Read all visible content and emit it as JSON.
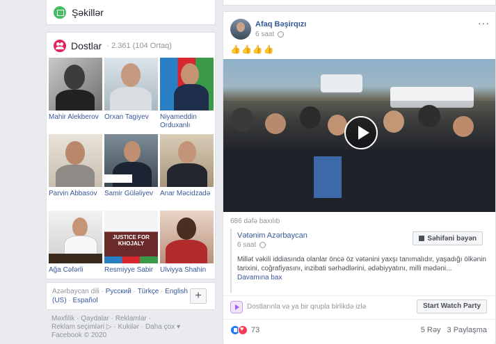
{
  "left": {
    "photos": {
      "label": "Şəkillər"
    },
    "friends": {
      "title": "Dostlar",
      "subtitle": "· 2.361 (104 Ortaq)",
      "items": [
        {
          "name": "Mahir Alekberov"
        },
        {
          "name": "Orxan Tagiyev"
        },
        {
          "name": "Niyameddin Orduxanlı"
        },
        {
          "name": "Parvin Abbasov"
        },
        {
          "name": "Samir Güləliyev"
        },
        {
          "name": "Anar Məcidzadə"
        },
        {
          "name": "Ağa Cəfərli"
        },
        {
          "name": "Resmiyye Sabir"
        },
        {
          "name": "Ulviyya Shahin"
        }
      ],
      "photo_captions": {
        "justice": "JUSTICE FOR",
        "khojaly": "KHOJALY"
      }
    },
    "languages": {
      "current": "Azərbaycan dili",
      "others": [
        "Русский",
        "Türkçe",
        "English (US)",
        "Español"
      ],
      "add_label": "+"
    },
    "footer": {
      "links": [
        "Məxfilik",
        "Qaydalar",
        "Reklamlar",
        "Reklam seçimləri ▷",
        "Kukilər",
        "Daha çox ▾"
      ],
      "copyright": "Facebook © 2020"
    }
  },
  "post": {
    "author": "Afaq Bəşirqızı",
    "time": "6 saat",
    "more": "···",
    "emojis": "👍👍👍👍",
    "views": "686 dəfə baxılıb",
    "shared": {
      "author": "Vətənim Azərbaycan",
      "time": "6 saat",
      "like_page": "Səhifəni bəyən",
      "text": "Millət vəkili iddiasında olanlar öncə öz vətənini yaxşı tanımalıdır, yaşadığı ölkənin tarixini, coğrafiyasını, inzibati sərhədlərini, ədəbiyyatını, milli mədəni...",
      "see_more": "Davamına bax"
    },
    "watch_party": {
      "text": "Dostlarınla və ya bir qrupla birlikdə izlə",
      "button": "Start Watch Party"
    },
    "reactions": {
      "count": "73",
      "comments": "5 Rəy",
      "shares": "3 Paylaşma"
    }
  },
  "colors": {
    "link": "#365899",
    "photos_icon": "#45bd62",
    "friends_icon": "#e0245e"
  }
}
